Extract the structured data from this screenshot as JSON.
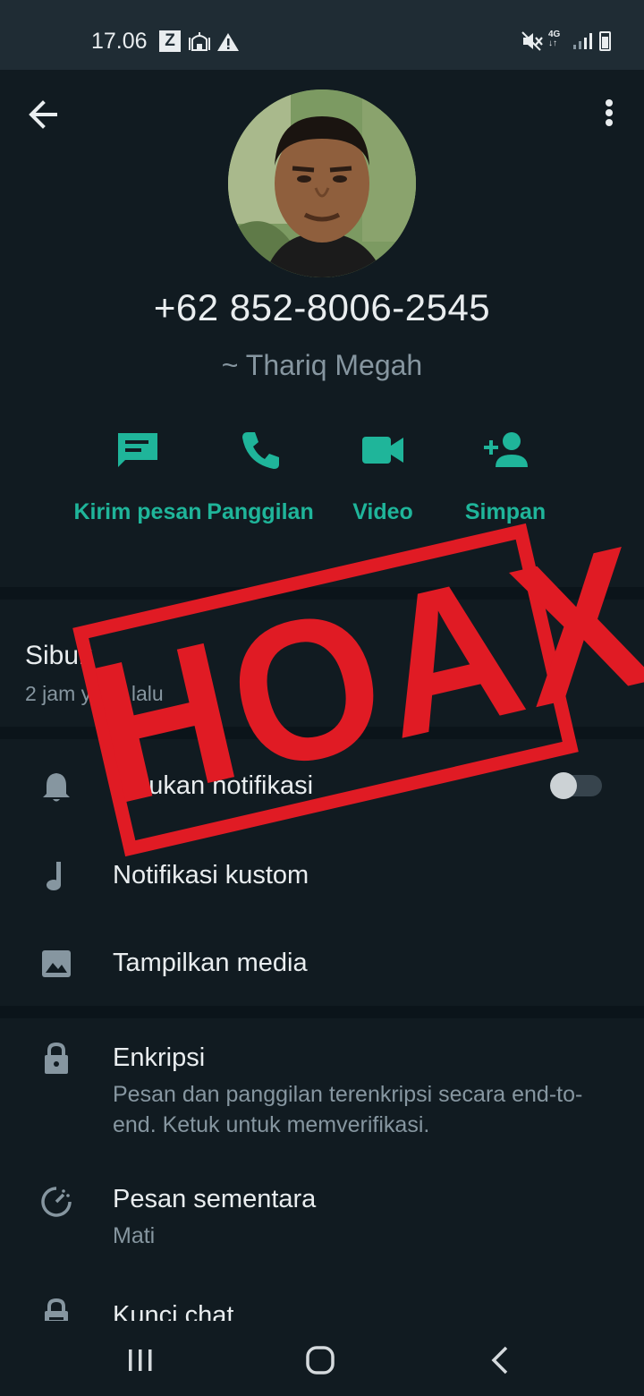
{
  "status_bar": {
    "time": "17.06",
    "z_badge": "Z",
    "network": "4G",
    "icons": [
      "z-icon",
      "mosque-icon",
      "warning-icon",
      "mute-icon",
      "network-4g-icon",
      "signal-icon",
      "battery-icon"
    ]
  },
  "header": {
    "back_icon": "arrow-left-icon",
    "more_icon": "more-vertical-icon"
  },
  "contact": {
    "phone": "+62 852-8006-2545",
    "name": "~ Thariq Megah"
  },
  "actions": [
    {
      "label": "Kirim pesan",
      "icon": "message-icon"
    },
    {
      "label": "Panggilan",
      "icon": "phone-icon"
    },
    {
      "label": "Video",
      "icon": "video-icon"
    },
    {
      "label": "Simpan",
      "icon": "add-contact-icon"
    }
  ],
  "about": {
    "text": "Sibuk",
    "time": "2 jam yang lalu"
  },
  "settings": [
    {
      "title": "Bisukan notifikasi",
      "icon": "bell-icon",
      "toggle_on": false
    },
    {
      "title": "Notifikasi kustom",
      "icon": "music-note-icon"
    },
    {
      "title": "Tampilkan media",
      "icon": "image-icon"
    }
  ],
  "security": [
    {
      "title": "Enkripsi",
      "subtitle": "Pesan dan panggilan terenkripsi secara end-to-end. Ketuk untuk memverifikasi.",
      "icon": "lock-icon"
    },
    {
      "title": "Pesan sementara",
      "subtitle": "Mati",
      "icon": "timer-icon"
    },
    {
      "title": "Kunci chat",
      "icon": "chat-lock-icon"
    }
  ],
  "stamp": {
    "text": "HOAX"
  },
  "colors": {
    "background": "#111b21",
    "accent": "#1fb59a",
    "stamp": "#e01b24",
    "secondary_text": "#8696a0"
  },
  "nav": {
    "icons": [
      "recent-apps-icon",
      "home-icon",
      "back-nav-icon"
    ]
  }
}
